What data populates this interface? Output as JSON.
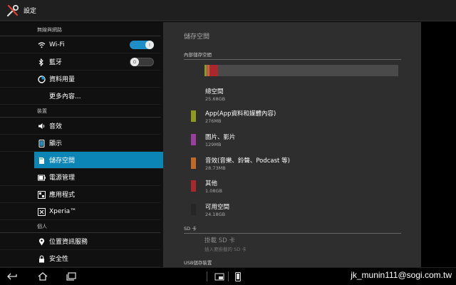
{
  "actionbar": {
    "title": "設定",
    "icon": "tools-icon"
  },
  "sidebar": {
    "sections": [
      {
        "header": "無線與網路"
      },
      {
        "header": "裝置"
      },
      {
        "header": "個人"
      }
    ],
    "items": [
      {
        "label": "Wi-Fi",
        "icon": "wifi-icon",
        "toggle": "on"
      },
      {
        "label": "藍牙",
        "icon": "bluetooth-icon",
        "toggle": "off"
      },
      {
        "label": "資料用量",
        "icon": "data-usage-icon"
      },
      {
        "label": "更多內容...",
        "icon": ""
      },
      {
        "label": "音效",
        "icon": "speaker-icon"
      },
      {
        "label": "顯示",
        "icon": "display-icon"
      },
      {
        "label": "儲存空間",
        "icon": "storage-icon",
        "selected": true
      },
      {
        "label": "電源管理",
        "icon": "battery-icon"
      },
      {
        "label": "應用程式",
        "icon": "apps-icon"
      },
      {
        "label": "Xperia™",
        "icon": "xperia-icon"
      },
      {
        "label": "位置資訊服務",
        "icon": "location-icon"
      },
      {
        "label": "安全性",
        "icon": "lock-icon"
      }
    ]
  },
  "storage": {
    "title": "儲存空間",
    "internal_header": "內部儲存空間",
    "sd_header": "SD 卡",
    "usb_header": "USB儲存裝置",
    "bar_fractions": {
      "app": 0.011,
      "media": 0.005,
      "audio": 0.011,
      "misc": 0.042,
      "free": 0.931
    },
    "rows": [
      {
        "title": "總空間",
        "value": "25.68GB",
        "color": ""
      },
      {
        "title": "App(App資料和媒體內容)",
        "value": "276MB",
        "color": "#8c9a1f"
      },
      {
        "title": "圖片、影片",
        "value": "129MB",
        "color": "#9a3ea0"
      },
      {
        "title": "音效(音樂、鈴聲、Podcast 等)",
        "value": "28.73MB",
        "color": "#c06a28"
      },
      {
        "title": "其他",
        "value": "1.08GB",
        "color": "#a8282e"
      },
      {
        "title": "可用空間",
        "value": "24.18GB",
        "color": "#2e2e2e"
      }
    ],
    "sd_mount": {
      "title": "掛載 SD 卡",
      "subtitle": "插入要掛載的 SD 卡"
    }
  },
  "watermark": "jk_munin111@sogi.com.tw",
  "colors": {
    "accent": "#0a85b5",
    "toggle_on": "#1e8ec8"
  }
}
